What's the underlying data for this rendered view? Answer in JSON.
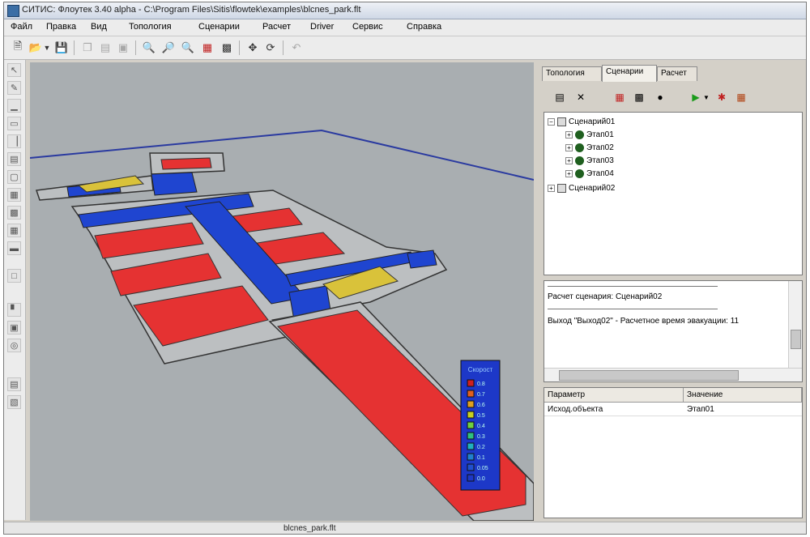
{
  "window": {
    "title": "СИТИС: Флоутек 3.40 alpha - C:\\Program Files\\Sitis\\flowtek\\examples\\blcnes_park.flt"
  },
  "menu": [
    "Файл",
    "Правка",
    "Вид",
    "Топология",
    "Сценарии",
    "Расчет",
    "Driver",
    "Сервис",
    "Справка"
  ],
  "toolbar_icons": [
    "new-file-icon",
    "open-folder-icon",
    "dropdown-arrow-icon",
    "save-icon",
    "copy-icon",
    "paste-icon",
    "print-icon",
    "zoom-in-icon",
    "zoom-out-icon",
    "zoom-fit-icon",
    "zoom-select-icon",
    "box-3d-icon",
    "pan-icon",
    "rotate-icon",
    "undo-icon"
  ],
  "left_tools": [
    "pointer-icon",
    "pencil-icon",
    "wall-icon",
    "door-icon",
    "stairs-icon",
    "window-icon",
    "room-icon",
    "level-icon",
    "layer-icon",
    "grid-icon",
    "measure-icon",
    "vertex-icon",
    "edge-icon",
    "link-icon",
    "sensor-icon",
    "export-icon"
  ],
  "right_panel": {
    "tabs": [
      "Топология",
      "Сценарии",
      "Расчет"
    ],
    "active_tab": 1,
    "tree": [
      {
        "level": 0,
        "label": "Сценарий01",
        "expanded": true,
        "icon": "scenario-icon"
      },
      {
        "level": 1,
        "label": "Этап01",
        "icon": "stage-icon"
      },
      {
        "level": 1,
        "label": "Этап02",
        "icon": "stage-icon"
      },
      {
        "level": 1,
        "label": "Этап03",
        "icon": "stage-icon"
      },
      {
        "level": 1,
        "label": "Этап04",
        "icon": "stage-icon"
      },
      {
        "level": 0,
        "label": "Сценарий02",
        "expanded": false,
        "icon": "scenario-icon"
      }
    ],
    "log": [
      "Расчет сценария: Сценарий02",
      "Выход \"Выход02\" - Расчетное время эвакуации: 11"
    ],
    "properties": {
      "headers": [
        "Параметр",
        "Значение"
      ],
      "rows": [
        [
          "Исход.объекта",
          "Этап01"
        ]
      ]
    }
  },
  "status": {
    "file": "blcnes_park.flt"
  },
  "colors": {
    "viewport_bg": "#a9aeb1",
    "floor_slab": "#bcbfc1",
    "room_red": "#e53232",
    "corridor_blue": "#1f45d0",
    "boundary_line": "#2a3aa0"
  },
  "legend": {
    "title": "Скорост",
    "values": [
      "0.8",
      "0.7",
      "0.6",
      "0.5",
      "0.4",
      "0.3",
      "0.2",
      "0.1",
      "0.05",
      "0.0"
    ],
    "colors": [
      "#d02020",
      "#e06020",
      "#e0a020",
      "#c8d020",
      "#70d040",
      "#30c080",
      "#20b0c0",
      "#2080d0",
      "#2050d0",
      "#1d38c8"
    ]
  }
}
